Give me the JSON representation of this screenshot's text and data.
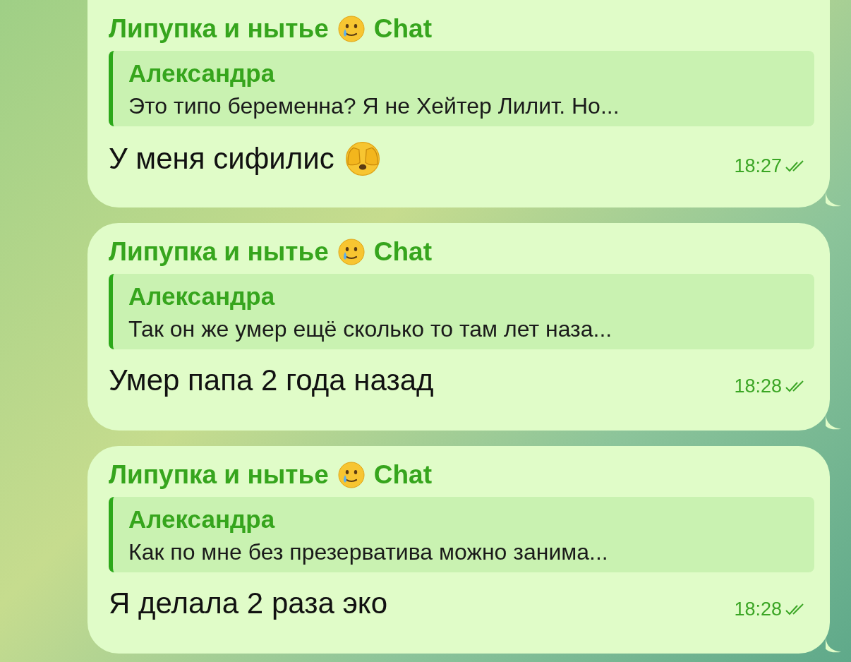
{
  "messages": [
    {
      "sender": "Липупка и нытье",
      "sender_suffix": "Chat",
      "reply": {
        "author": "Александра",
        "text": "Это типо беременна? Я не Хейтер Лилит. Но..."
      },
      "text": "У меня сифилис",
      "has_emoji": true,
      "time": "18:27",
      "read": true
    },
    {
      "sender": "Липупка и нытье",
      "sender_suffix": "Chat",
      "reply": {
        "author": "Александра",
        "text": "Так он же умер ещё сколько то там лет наза..."
      },
      "text": "Умер папа 2 года назад",
      "time": "18:28",
      "read": true
    },
    {
      "sender": "Липупка и нытье",
      "sender_suffix": "Chat",
      "reply": {
        "author": "Александра",
        "text": "Как по мне без презерватива можно занима..."
      },
      "text": "Я делала 2 раза эко",
      "time": "18:28",
      "read": true
    }
  ]
}
